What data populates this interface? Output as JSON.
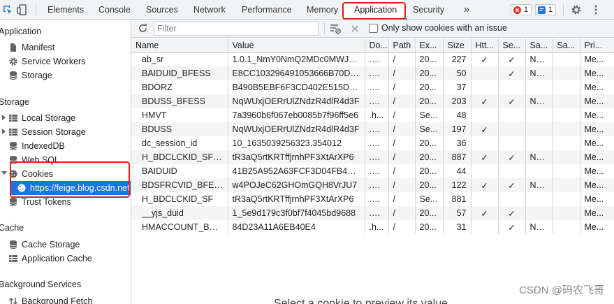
{
  "tabs": [
    {
      "label": "Elements",
      "active": false
    },
    {
      "label": "Console",
      "active": false
    },
    {
      "label": "Sources",
      "active": false
    },
    {
      "label": "Network",
      "active": false
    },
    {
      "label": "Performance",
      "active": false
    },
    {
      "label": "Memory",
      "active": false
    },
    {
      "label": "Application",
      "active": true
    },
    {
      "label": "Security",
      "active": false
    }
  ],
  "more_tabs": "»",
  "badges": {
    "errors": "1",
    "messages": "1"
  },
  "accent_color": "#1a73e8",
  "highlight_color": "#e0201a",
  "sidebar": {
    "application_header": "Application",
    "manifest": "Manifest",
    "service_workers": "Service Workers",
    "storage_item": "Storage",
    "storage_header": "Storage",
    "local_storage": "Local Storage",
    "session_storage": "Session Storage",
    "indexeddb": "IndexedDB",
    "web_sql": "Web SQL",
    "cookies": "Cookies",
    "cookie_origin": "https://feige.blog.csdn.net",
    "trust_tokens": "Trust Tokens",
    "cache_header": "Cache",
    "cache_storage": "Cache Storage",
    "application_cache": "Application Cache",
    "background_header": "Background Services",
    "background_fetch": "Background Fetch"
  },
  "toolbar": {
    "filter_placeholder": "Filter",
    "only_issue_label": "Only show cookies with an issue"
  },
  "columns": [
    "Name",
    "Value",
    "Do...",
    "Path",
    "Ex...",
    "Size",
    "Htt...",
    "Se...",
    "Sa...",
    "Sa...",
    "Pri..."
  ],
  "rows": [
    [
      "ab_sr",
      "1.0.1_NmY0NmQ2MDc0MWJmN",
      ".ba...",
      "/",
      "20...",
      "227",
      "✓",
      "✓",
      "None",
      "",
      "Me..."
    ],
    [
      "BAIDUID_BFESS",
      "E8CC103296491053666B70DF5",
      ".ba...",
      "/",
      "20...",
      "50",
      "",
      "✓",
      "None",
      "",
      "Me..."
    ],
    [
      "BDORZ",
      "B490B5EBF6F3CD402E515D22B",
      ".ba...",
      "/",
      "20...",
      "37",
      "",
      "",
      "",
      "",
      "Me..."
    ],
    [
      "BDUSS_BFESS",
      "NqWUxjOERrUlZNdzR4dlR4d3F",
      ".ba...",
      "/",
      "20...",
      "203",
      "✓",
      "✓",
      "None",
      "",
      "Me..."
    ],
    [
      "HMVT",
      "7a3960b6f067eb0085b7f96ff5e6",
      ".h...",
      "/",
      "Se...",
      "48",
      "",
      "",
      "",
      "",
      "Me..."
    ],
    [
      "BDUSS",
      "NqWUxjOERrUlZNdzR4dlR4d3F",
      ".ba...",
      "/",
      "Se...",
      "197",
      "✓",
      "",
      "",
      "",
      "Me..."
    ],
    [
      "dc_session_id",
      "10_1635039256323.354012",
      ".cs...",
      "/",
      "20...",
      "36",
      "",
      "",
      "",
      "",
      "Me..."
    ],
    [
      "H_BDCLCKID_SF_BFESS",
      "tR3aQ5rtKRTffjrnhPF3XtArXP6",
      ".ba...",
      "/",
      "20...",
      "887",
      "✓",
      "✓",
      "None",
      "",
      "Me..."
    ],
    [
      "BAIDUID",
      "41B25A952A63FCF3D04FB4BE7",
      ".ba...",
      "/",
      "20...",
      "44",
      "",
      "",
      "",
      "",
      "Me..."
    ],
    [
      "BDSFRCVID_BFESS",
      "w4POJeC62GHOmGQH8VrJU7",
      ".ba...",
      "/",
      "20...",
      "122",
      "✓",
      "✓",
      "None",
      "",
      "Me..."
    ],
    [
      "H_BDCLCKID_SF",
      "tR3aQ5rtKRTffjrnhPF3XtArXP6",
      ".ba...",
      "/",
      "Se...",
      "881",
      "",
      "",
      "",
      "",
      "Me..."
    ],
    [
      "__yjs_duid",
      "1_5e9d179c3f0bf7f4045bd9688",
      ".ba...",
      "/",
      "20...",
      "57",
      "✓",
      "✓",
      "",
      "",
      "Me..."
    ],
    [
      "HMACCOUNT_BFESS",
      "84D23A11A6EB40E4",
      ".h...",
      "/",
      "20...",
      "31",
      "",
      "✓",
      "None",
      "",
      "Me..."
    ]
  ],
  "watermark": "CSDN @码农飞哥",
  "cut_text": "Select a cookie to preview its value"
}
